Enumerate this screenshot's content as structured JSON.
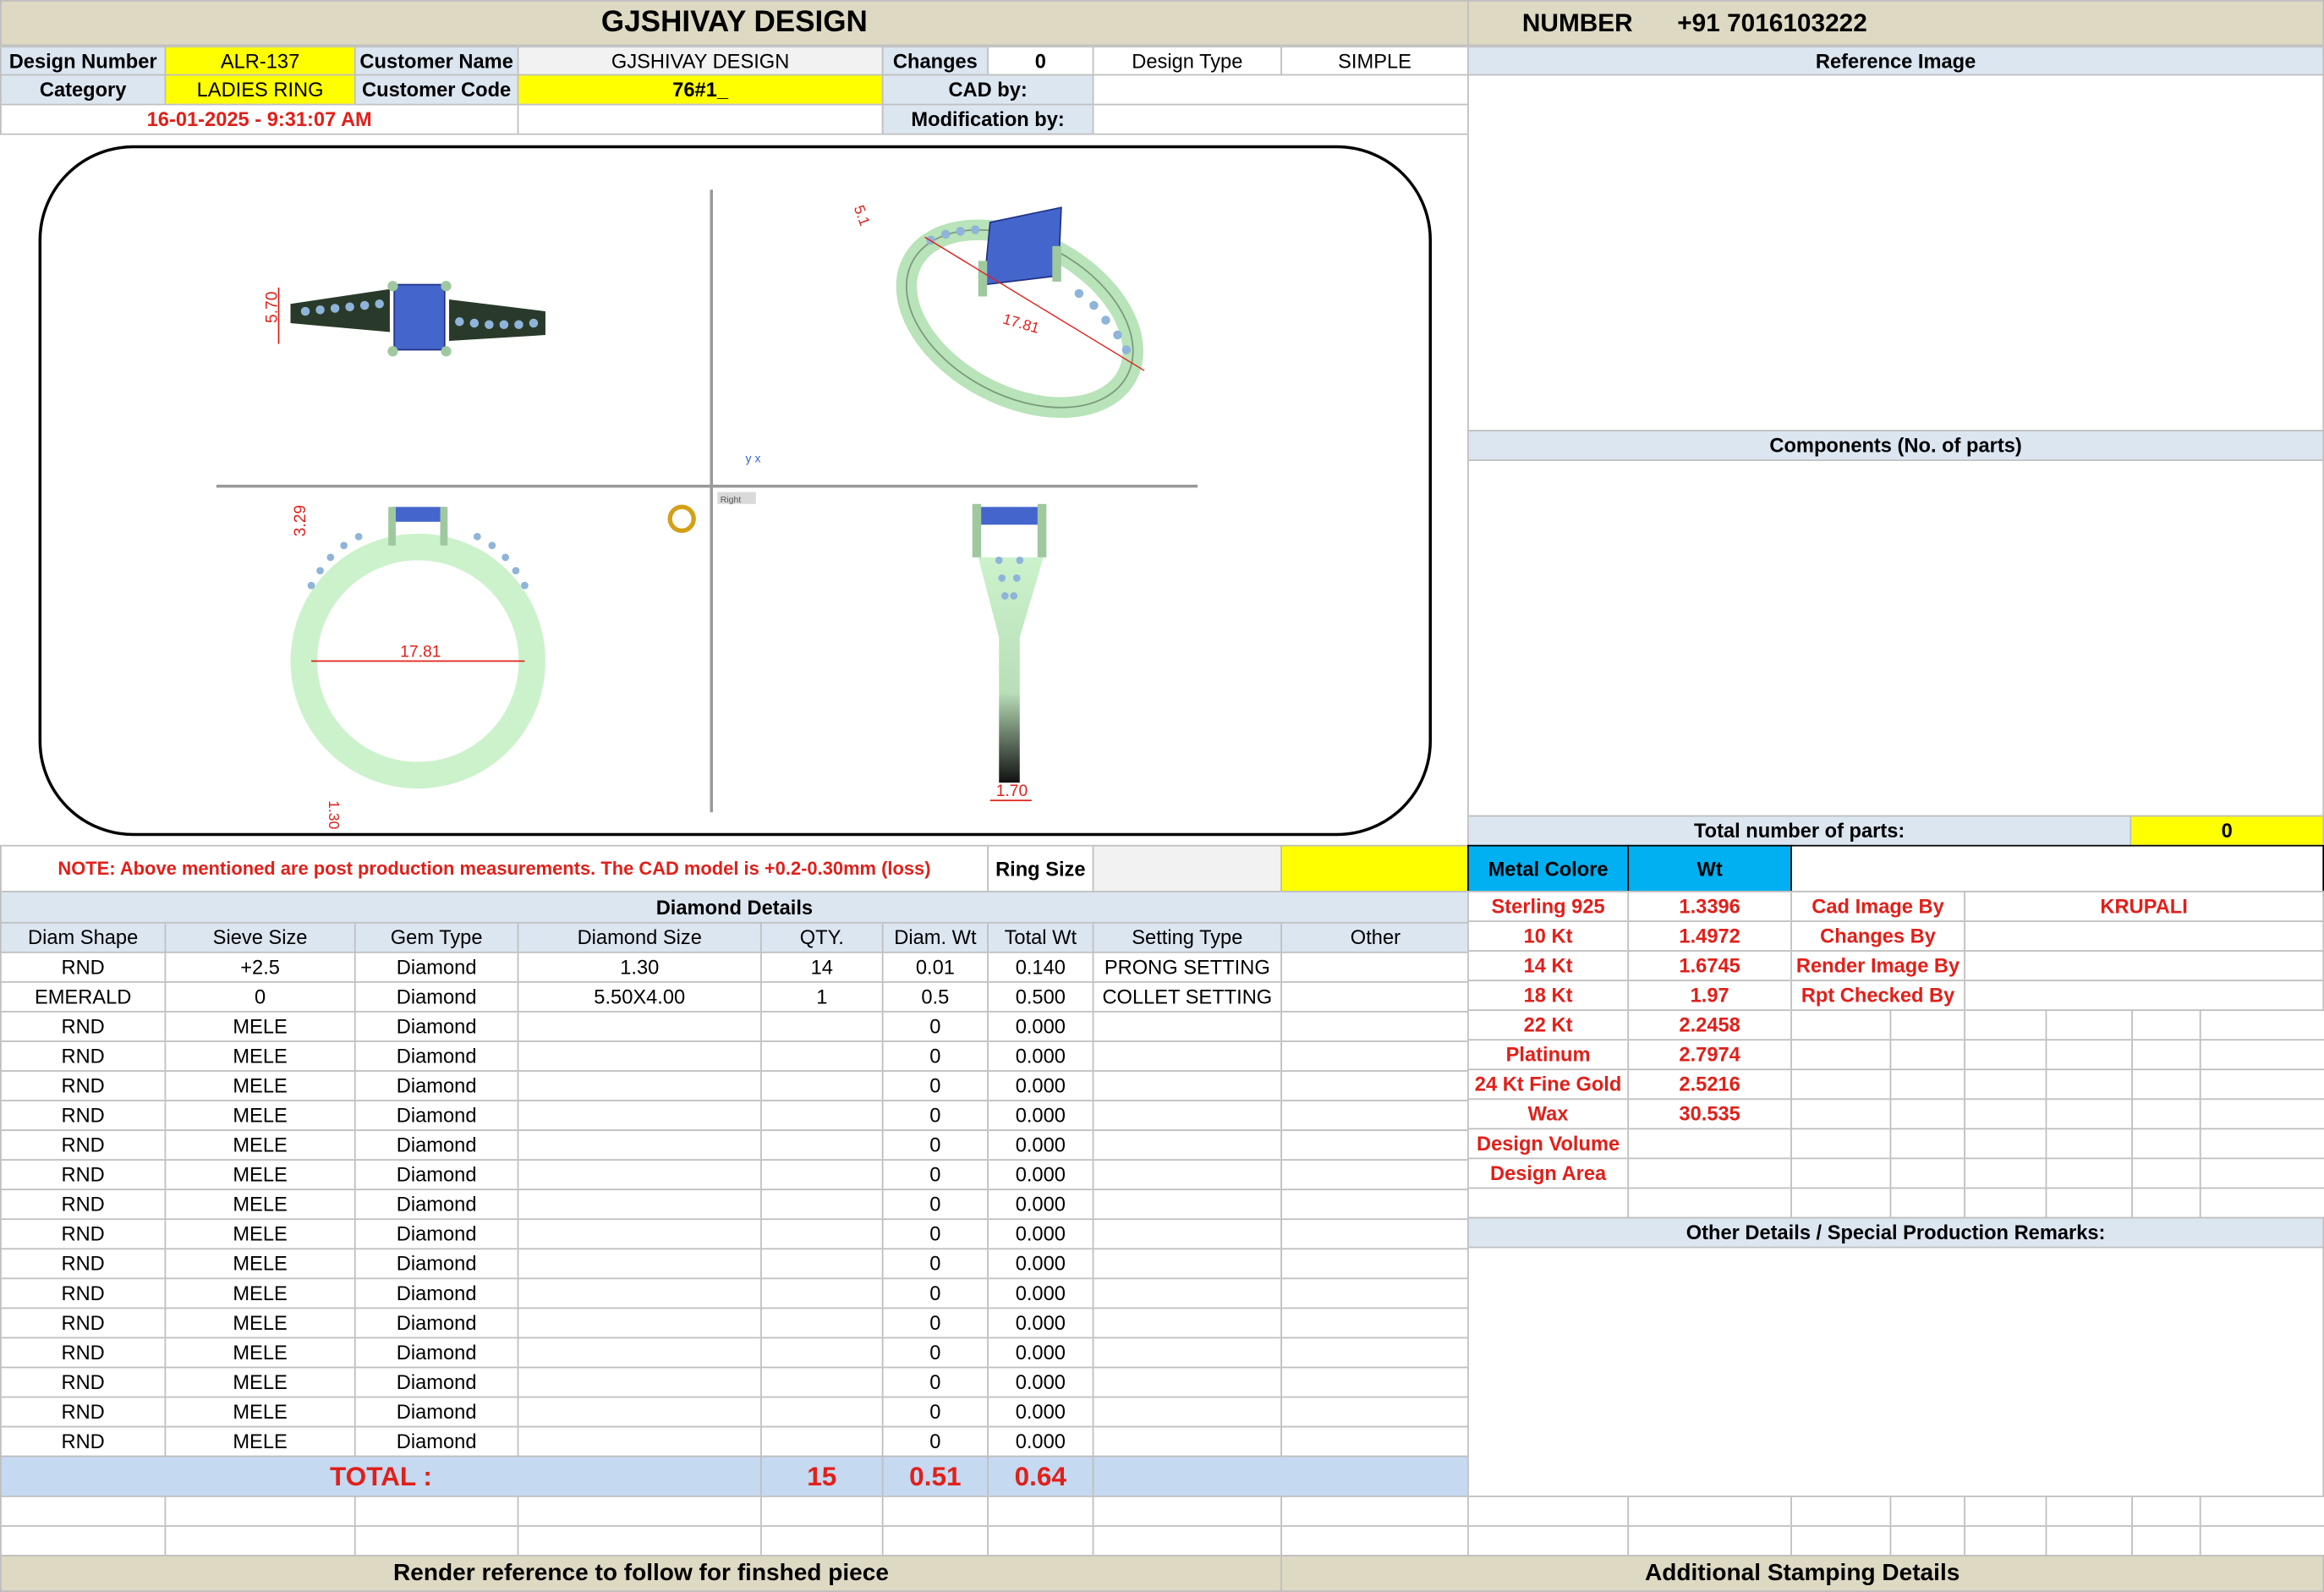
{
  "header": {
    "title": "GJSHIVAY DESIGN",
    "number_label": "NUMBER",
    "number_value": "+91 7016103222"
  },
  "info": {
    "design_number_label": "Design Number",
    "design_number": "ALR-137",
    "customer_name_label": "Customer Name",
    "customer_name": "GJSHIVAY DESIGN",
    "changes_label": "Changes",
    "changes": "0",
    "design_type_label": "Design Type",
    "design_type": "SIMPLE",
    "category_label": "Category",
    "category": "LADIES RING",
    "customer_code_label": "Customer Code",
    "customer_code": "76#1_",
    "cad_by_label": "CAD by:",
    "cad_by": "",
    "datetime": "16-01-2025 - 9:31:07 AM",
    "modification_label": "Modification by:",
    "modification_by": ""
  },
  "right": {
    "reference_image": "Reference Image",
    "components": "Components (No. of parts)",
    "total_parts_label": "Total number of parts:",
    "total_parts": "0",
    "other_details": "Other Details / Special Production Remarks:"
  },
  "drawing": {
    "dim_top_height": "5.70",
    "dim_persp_1": "5.1",
    "dim_persp_2": "17.81",
    "dim_front_height": "3.29",
    "dim_front_inner": "17.81",
    "dim_front_band": "1.30",
    "dim_side_width": "1.70",
    "view_label": "Right"
  },
  "note": "NOTE: Above mentioned are post production measurements. The CAD model is +0.2-0.30mm (loss)",
  "ring_size_label": "Ring Size",
  "ring_size": "",
  "metal": {
    "header_color": "Metal Colore",
    "header_wt": "Wt",
    "rows": [
      {
        "name": "Sterling 925",
        "wt": "1.3396"
      },
      {
        "name": "10 Kt",
        "wt": "1.4972"
      },
      {
        "name": "14 Kt",
        "wt": "1.6745"
      },
      {
        "name": "18 Kt",
        "wt": "1.97"
      },
      {
        "name": "22 Kt",
        "wt": "2.2458"
      },
      {
        "name": "Platinum",
        "wt": "2.7974"
      },
      {
        "name": "24 Kt Fine Gold",
        "wt": "2.5216"
      },
      {
        "name": "Wax",
        "wt": "30.535"
      },
      {
        "name": "Design Volume",
        "wt": ""
      },
      {
        "name": "Design Area",
        "wt": ""
      }
    ]
  },
  "staff": [
    {
      "label": "Cad Image By",
      "value": "KRUPALI"
    },
    {
      "label": "Changes By",
      "value": ""
    },
    {
      "label": "Render Image By",
      "value": ""
    },
    {
      "label": "Rpt Checked By",
      "value": ""
    }
  ],
  "diamond": {
    "title": "Diamond Details",
    "headers": [
      "Diam Shape",
      "Sieve Size",
      "Gem Type",
      "Diamond Size",
      "QTY.",
      "Diam. Wt",
      "Total Wt",
      "Setting Type",
      "Other"
    ],
    "rows": [
      [
        "RND",
        "+2.5",
        "Diamond",
        "1.30",
        "14",
        "0.01",
        "0.140",
        "PRONG SETTING",
        ""
      ],
      [
        "EMERALD",
        "0",
        "Diamond",
        "5.50X4.00",
        "1",
        "0.5",
        "0.500",
        "COLLET SETTING",
        ""
      ],
      [
        "RND",
        "MELE",
        "Diamond",
        "",
        "",
        "0",
        "0.000",
        "",
        ""
      ],
      [
        "RND",
        "MELE",
        "Diamond",
        "",
        "",
        "0",
        "0.000",
        "",
        ""
      ],
      [
        "RND",
        "MELE",
        "Diamond",
        "",
        "",
        "0",
        "0.000",
        "",
        ""
      ],
      [
        "RND",
        "MELE",
        "Diamond",
        "",
        "",
        "0",
        "0.000",
        "",
        ""
      ],
      [
        "RND",
        "MELE",
        "Diamond",
        "",
        "",
        "0",
        "0.000",
        "",
        ""
      ],
      [
        "RND",
        "MELE",
        "Diamond",
        "",
        "",
        "0",
        "0.000",
        "",
        ""
      ],
      [
        "RND",
        "MELE",
        "Diamond",
        "",
        "",
        "0",
        "0.000",
        "",
        ""
      ],
      [
        "RND",
        "MELE",
        "Diamond",
        "",
        "",
        "0",
        "0.000",
        "",
        ""
      ],
      [
        "RND",
        "MELE",
        "Diamond",
        "",
        "",
        "0",
        "0.000",
        "",
        ""
      ],
      [
        "RND",
        "MELE",
        "Diamond",
        "",
        "",
        "0",
        "0.000",
        "",
        ""
      ],
      [
        "RND",
        "MELE",
        "Diamond",
        "",
        "",
        "0",
        "0.000",
        "",
        ""
      ],
      [
        "RND",
        "MELE",
        "Diamond",
        "",
        "",
        "0",
        "0.000",
        "",
        ""
      ],
      [
        "RND",
        "MELE",
        "Diamond",
        "",
        "",
        "0",
        "0.000",
        "",
        ""
      ],
      [
        "RND",
        "MELE",
        "Diamond",
        "",
        "",
        "0",
        "0.000",
        "",
        ""
      ],
      [
        "RND",
        "MELE",
        "Diamond",
        "",
        "",
        "0",
        "0.000",
        "",
        ""
      ]
    ],
    "total_label": "TOTAL :",
    "total_qty": "15",
    "total_diam_wt": "0.51",
    "total_wt": "0.64"
  },
  "footer": {
    "render_ref": "Render reference to follow for finshed piece",
    "stamping": "Additional Stamping Details"
  },
  "colors": {
    "title_bg": "#ddd9c3",
    "label_bg": "#dce6f1",
    "highlight": "#ffff00",
    "metal_header": "#00b0f0",
    "accent_red": "#e0201a",
    "ring_metal": "#ccf2cc",
    "gem_blue": "#4466cc"
  }
}
